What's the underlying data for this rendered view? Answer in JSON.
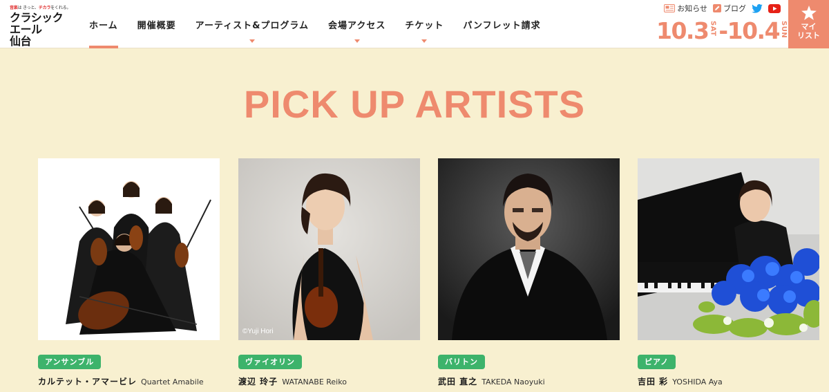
{
  "logo": {
    "tagline_red1": "音楽",
    "tagline_mid": "は きっと、",
    "tagline_red2": "チカラ",
    "tagline_end": "をくれる。",
    "line1": "クラシック",
    "line2": "エール",
    "line3": "仙台"
  },
  "nav": [
    {
      "label": "ホーム",
      "active": true,
      "dropdown": false
    },
    {
      "label": "開催概要",
      "active": false,
      "dropdown": false
    },
    {
      "label": "アーティスト&プログラム",
      "active": false,
      "dropdown": true
    },
    {
      "label": "会場アクセス",
      "active": false,
      "dropdown": true
    },
    {
      "label": "チケット",
      "active": false,
      "dropdown": true
    },
    {
      "label": "パンフレット請求",
      "active": false,
      "dropdown": false
    }
  ],
  "util": {
    "news_label": "お知らせ",
    "blog_label": "ブログ",
    "news_icon": "news-icon",
    "blog_icon": "pencil-icon",
    "twitter_icon": "twitter-icon",
    "youtube_icon": "youtube-icon"
  },
  "dates": {
    "start": "10.3",
    "start_day": "SAT",
    "end": "-10.4",
    "end_day": "SUN"
  },
  "mylist": {
    "line1": "マイ",
    "line2": "リスト",
    "icon": "star-icon"
  },
  "section": {
    "title": "PICK UP ARTISTS"
  },
  "artists": [
    {
      "category": "アンサンブル",
      "name_jp": "カルテット・アマービレ",
      "name_en": "Quartet Amabile",
      "credit": ""
    },
    {
      "category": "ヴァイオリン",
      "name_jp": "渡辺 玲子",
      "name_en": "WATANABE Reiko",
      "credit": "©Yuji Hori"
    },
    {
      "category": "バリトン",
      "name_jp": "武田 直之",
      "name_en": "TAKEDA Naoyuki",
      "credit": ""
    },
    {
      "category": "ピアノ",
      "name_jp": "吉田 彩",
      "name_en": "YOSHIDA Aya",
      "credit": ""
    }
  ],
  "colors": {
    "accent": "#ee8a6e",
    "background": "#f8f0d0",
    "badge": "#3db36b"
  }
}
